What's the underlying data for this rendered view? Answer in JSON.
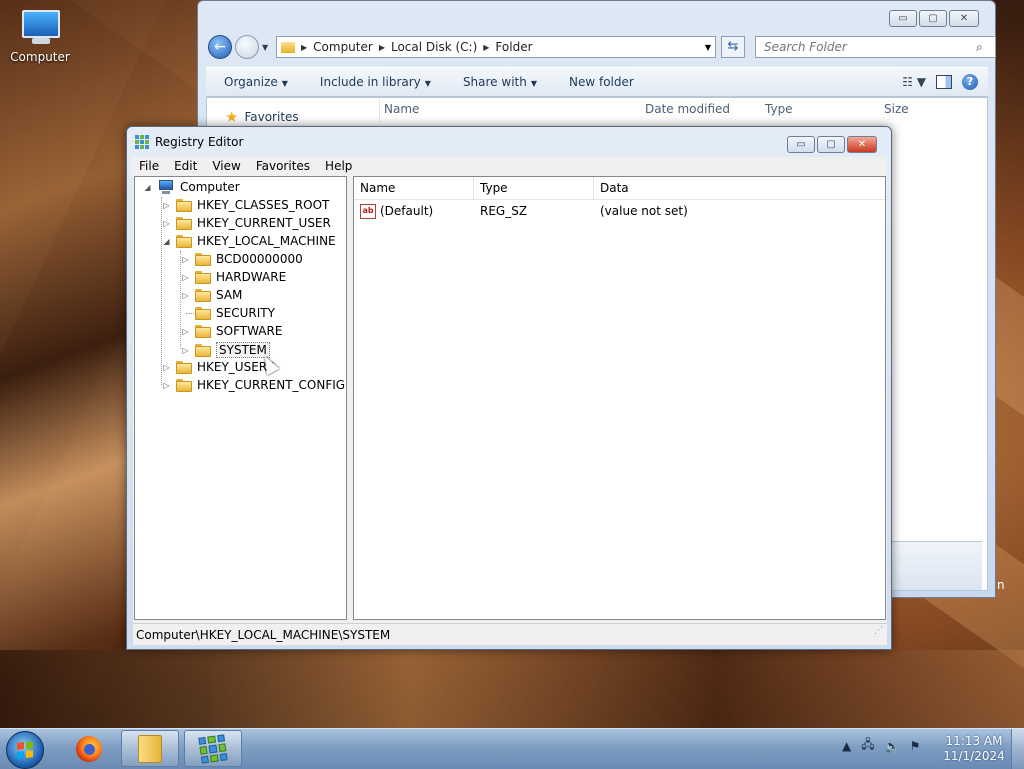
{
  "desktop": {
    "icon_label": "Computer",
    "stray_text": "n"
  },
  "explorer": {
    "caption_buttons": {
      "minimize": "▭",
      "maximize": "▢",
      "close": "✕"
    },
    "address": {
      "segments": [
        "Computer",
        "Local Disk (C:)",
        "Folder"
      ]
    },
    "search_placeholder": "Search Folder",
    "toolbar": {
      "organize": "Organize",
      "include": "Include in library",
      "share": "Share with",
      "new_folder": "New folder"
    },
    "favorites": "Favorites",
    "columns": [
      "Name",
      "Date modified",
      "Type",
      "Size"
    ]
  },
  "registry": {
    "title": "Registry Editor",
    "caption_buttons": {
      "minimize": "▭",
      "maximize": "▢",
      "close": "✕"
    },
    "menu": [
      "File",
      "Edit",
      "View",
      "Favorites",
      "Help"
    ],
    "tree": {
      "root": "Computer",
      "hives": [
        "HKEY_CLASSES_ROOT",
        "HKEY_CURRENT_USER",
        "HKEY_LOCAL_MACHINE",
        "HKEY_USERS",
        "HKEY_CURRENT_CONFIG"
      ],
      "hklm_children": [
        "BCD00000000",
        "HARDWARE",
        "SAM",
        "SECURITY",
        "SOFTWARE",
        "SYSTEM"
      ],
      "selected": "SYSTEM"
    },
    "value_columns": [
      "Name",
      "Type",
      "Data"
    ],
    "values": [
      {
        "name": "(Default)",
        "type": "REG_SZ",
        "data": "(value not set)"
      }
    ],
    "status": "Computer\\HKEY_LOCAL_MACHINE\\SYSTEM"
  },
  "taskbar": {
    "time": "11:13 AM",
    "date": "11/1/2024"
  },
  "icons": {
    "string_value": "ab"
  }
}
